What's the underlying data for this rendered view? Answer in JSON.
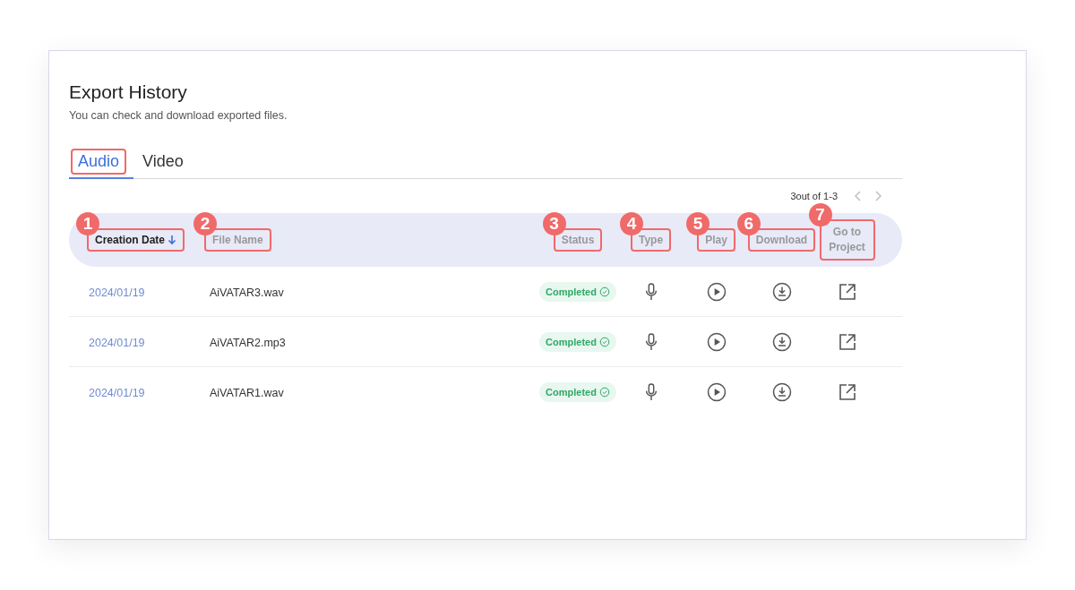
{
  "page": {
    "title": "Export History",
    "subtitle": "You can check and download exported files."
  },
  "tabs": [
    {
      "label": "Audio",
      "selected": true,
      "highlighted": true
    },
    {
      "label": "Video",
      "selected": false,
      "highlighted": false
    }
  ],
  "pagination": {
    "text": "3out of 1-3"
  },
  "table": {
    "columns": [
      {
        "label": "Creation Date",
        "callout": "1",
        "sorted": true
      },
      {
        "label": "File Name",
        "callout": "2",
        "sorted": false
      },
      {
        "label": "Status",
        "callout": "3",
        "sorted": false
      },
      {
        "label": "Type",
        "callout": "4",
        "sorted": false
      },
      {
        "label": "Play",
        "callout": "5",
        "sorted": false
      },
      {
        "label": "Download",
        "callout": "6",
        "sorted": false
      },
      {
        "label": "Go to Project",
        "callout": "7",
        "sorted": false
      }
    ],
    "rows": [
      {
        "date": "2024/01/19",
        "file_name": "AiVATAR3.wav",
        "status": "Completed"
      },
      {
        "date": "2024/01/19",
        "file_name": "AiVATAR2.mp3",
        "status": "Completed"
      },
      {
        "date": "2024/01/19",
        "file_name": "AiVATAR1.wav",
        "status": "Completed"
      }
    ]
  }
}
